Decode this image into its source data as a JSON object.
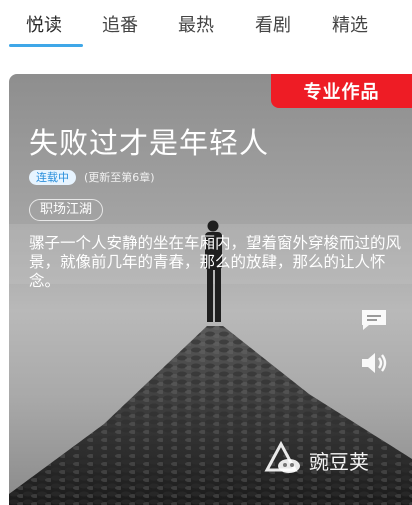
{
  "tabs": [
    {
      "label": "悦读",
      "active": true
    },
    {
      "label": "追番",
      "active": false
    },
    {
      "label": "最热",
      "active": false
    },
    {
      "label": "看剧",
      "active": false
    },
    {
      "label": "精选",
      "active": false
    }
  ],
  "colors": {
    "tab_indicator": "#3fa7e8",
    "pro_badge": "#ee1c25",
    "status_text": "#2a8fdc"
  },
  "card": {
    "pro_label": "专业作品",
    "title": "失败过才是年轻人",
    "status": "连载中",
    "update": "(更新至第6章)",
    "genre": "职场江湖",
    "description": "骡子一个人安静的坐在车厢内，望着窗外穿梭而过的风景，就像前几年的青春，那么的放肆，那么的让人怀念。",
    "icons": [
      "comment-icon",
      "sound-icon"
    ]
  },
  "watermark": {
    "text": "豌豆荚",
    "icon": "wandoujia-logo-icon"
  }
}
